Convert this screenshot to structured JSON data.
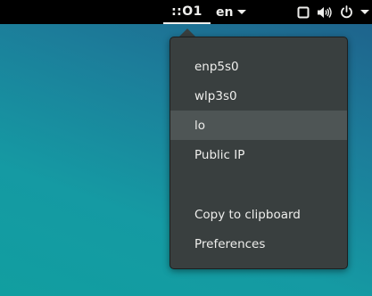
{
  "topbar": {
    "ip_indicator": "::O1",
    "language": "en",
    "icons": [
      "window-icon",
      "volume-icon",
      "power-icon",
      "chevron-down-icon"
    ]
  },
  "popup": {
    "items": [
      {
        "label": "enp5s0"
      },
      {
        "label": "wlp3s0"
      },
      {
        "label": "lo"
      },
      {
        "label": "Public IP"
      }
    ],
    "actions": [
      {
        "label": "Copy to clipboard"
      },
      {
        "label": "Preferences"
      }
    ]
  },
  "colors": {
    "topbar_bg": "#000000",
    "popup_bg": "#393f3f",
    "highlight_bg": "#4e5555",
    "text": "#eeeeec"
  }
}
